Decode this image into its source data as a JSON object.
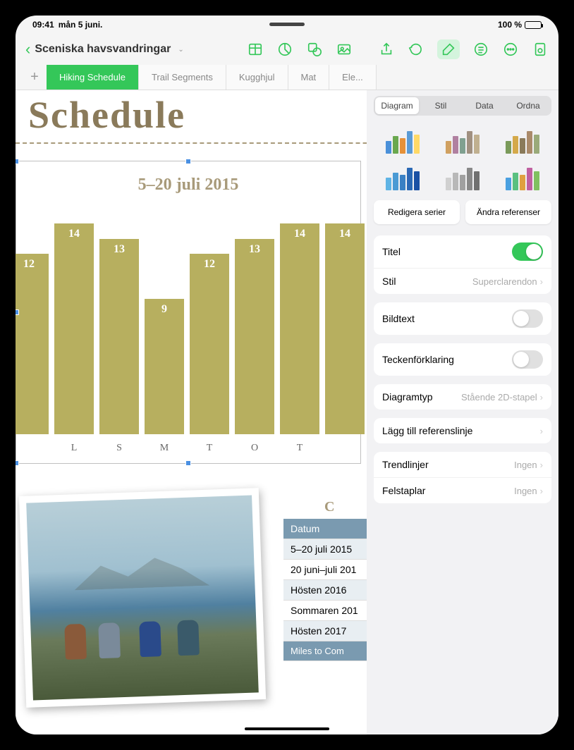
{
  "status": {
    "time": "09:41",
    "date": "mån 5 juni.",
    "battery": "100 %"
  },
  "doc": {
    "title": "Sceniska havsvandringar"
  },
  "tabs": [
    "Hiking Schedule",
    "Trail Segments",
    "Kugghjul",
    "Mat",
    "Ele..."
  ],
  "page_title": "Schedule",
  "chart_data": {
    "type": "bar",
    "title": "5–20 juli 2015",
    "categories": [
      "",
      "L",
      "S",
      "M",
      "T",
      "O",
      "T",
      ""
    ],
    "values": [
      12,
      14,
      13,
      9,
      12,
      13,
      14,
      14
    ],
    "ylim": [
      0,
      15
    ]
  },
  "table": {
    "partial_header": "C",
    "header": "Datum",
    "rows": [
      "5–20 juli 2015",
      "20 juni–juli 201",
      "Hösten 2016",
      "Sommaren 201",
      "Hösten 2017"
    ],
    "footer": "Miles to Com"
  },
  "sidebar": {
    "tabs": [
      "Diagram",
      "Stil",
      "Data",
      "Ordna"
    ],
    "edit_series": "Redigera serier",
    "change_refs": "Ändra referenser",
    "title": {
      "label": "Titel",
      "on": true
    },
    "style": {
      "label": "Stil",
      "value": "Superclarendon"
    },
    "caption": {
      "label": "Bildtext",
      "on": false
    },
    "legend": {
      "label": "Teckenförklaring",
      "on": false
    },
    "chart_type": {
      "label": "Diagramtyp",
      "value": "Stående 2D-stapel"
    },
    "add_ref": "Lägg till referenslinje",
    "trendlines": {
      "label": "Trendlinjer",
      "value": "Ingen"
    },
    "errorbars": {
      "label": "Felstaplar",
      "value": "Ingen"
    }
  }
}
